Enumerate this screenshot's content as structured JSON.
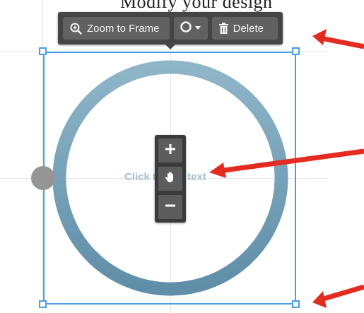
{
  "caption": {
    "text": "Modify your design"
  },
  "toolbar": {
    "zoom_label": "Zoom to Frame",
    "delete_label": "Delete",
    "shape_icon": "circle-outline-icon",
    "dropdown_icon": "caret-down-icon"
  },
  "shape": {
    "type": "circle",
    "text": "Click to add text",
    "stroke_color": "#7ba7bd"
  },
  "selection": {
    "color": "#4a9ee3"
  },
  "zoom_controls": {
    "plus_label": "+",
    "minus_label": "−",
    "pan_icon": "hand-icon"
  },
  "annotations": {
    "arrow_color": "#e32b1f"
  }
}
